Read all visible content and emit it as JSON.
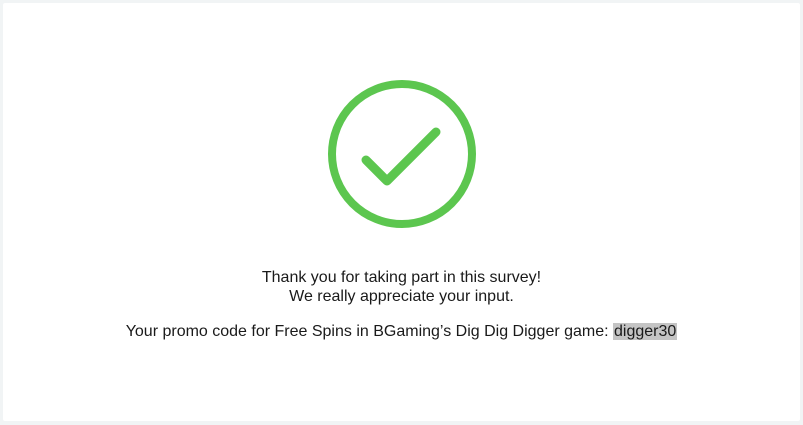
{
  "icon": {
    "name": "checkmark-circle-icon",
    "color": "#5cc64f"
  },
  "message": {
    "line1": "Thank you for taking part in this survey!",
    "line2": "We really appreciate your input."
  },
  "promo": {
    "label": "Your promo code for Free Spins in BGaming’s Dig Dig Digger game: ",
    "code": "digger30",
    "code_highlight": "#c4c4c4"
  }
}
